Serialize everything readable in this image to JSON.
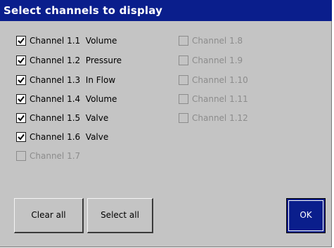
{
  "dialog": {
    "title": "Select channels to display"
  },
  "channels_col1": [
    {
      "label": "Channel 1.1  Volume",
      "checked": true,
      "enabled": true
    },
    {
      "label": "Channel 1.2  Pressure",
      "checked": true,
      "enabled": true
    },
    {
      "label": "Channel 1.3  In Flow",
      "checked": true,
      "enabled": true
    },
    {
      "label": "Channel 1.4  Volume",
      "checked": true,
      "enabled": true
    },
    {
      "label": "Channel 1.5  Valve",
      "checked": true,
      "enabled": true
    },
    {
      "label": "Channel 1.6  Valve",
      "checked": true,
      "enabled": true
    },
    {
      "label": "Channel 1.7",
      "checked": false,
      "enabled": false
    }
  ],
  "channels_col2": [
    {
      "label": "Channel 1.8",
      "checked": false,
      "enabled": false
    },
    {
      "label": "Channel 1.9",
      "checked": false,
      "enabled": false
    },
    {
      "label": "Channel 1.10",
      "checked": false,
      "enabled": false
    },
    {
      "label": "Channel 1.11",
      "checked": false,
      "enabled": false
    },
    {
      "label": "Channel 1.12",
      "checked": false,
      "enabled": false
    }
  ],
  "buttons": {
    "clear_all": "Clear all",
    "select_all": "Select all",
    "ok": "OK"
  },
  "colors": {
    "title_bg": "#0a1e8c",
    "dialog_bg": "#c4c4c4",
    "disabled_text": "#8c8c8c"
  }
}
